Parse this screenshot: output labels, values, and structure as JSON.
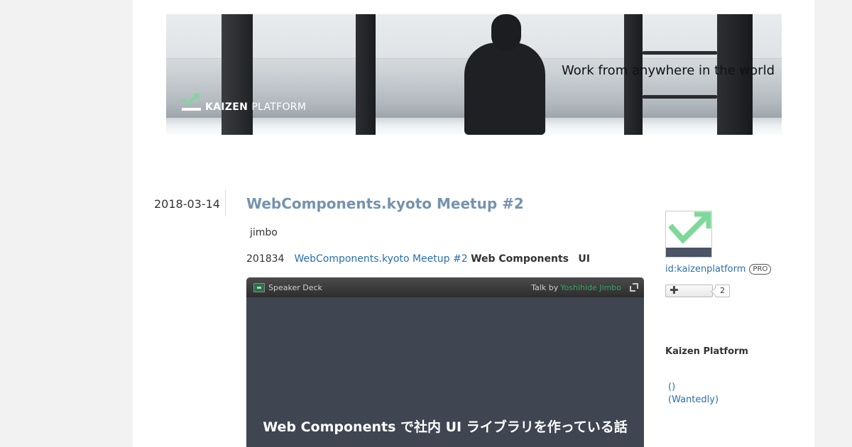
{
  "banner": {
    "tagline": "Work from anywhere in the world",
    "logo_text": "KAIZEN",
    "logo_text_thin": "PLATFORM",
    "logo_color": "#7ed89a"
  },
  "entry": {
    "date": "2018-03-14",
    "title": "WebComponents.kyoto Meetup #2",
    "author": "jimbo",
    "intro_prefix": "201834",
    "intro_link": "WebComponents.kyoto Meetup #2",
    "intro_bold": "Web Components",
    "intro_suffix": "UI",
    "link_color": "#2a6fb0",
    "title_color": "#7593ae"
  },
  "speakerdeck": {
    "brand": "Speaker Deck",
    "talk_by": "Talk by",
    "speaker": "Yoshihide Jimbo",
    "slide_title": "Web Components で社内 UI ライブラリを作っている話",
    "accent": "#3aa36b"
  },
  "sidebar": {
    "profile_id": "id:kaizenplatform",
    "pro_badge": "PRO",
    "follow_symbol": "✚",
    "follow_count": "2",
    "heading": "Kaizen Platform",
    "links": [
      "()",
      "(Wantedly)"
    ]
  }
}
